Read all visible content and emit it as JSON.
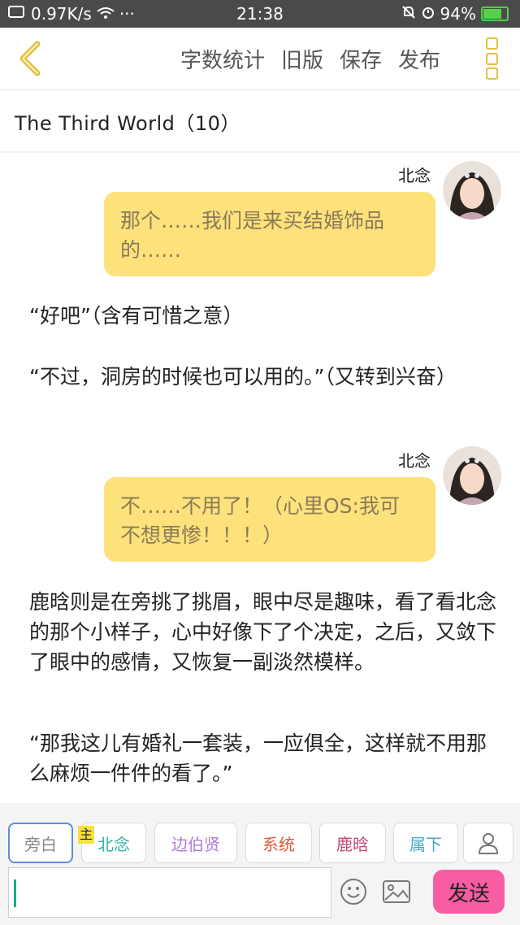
{
  "status_bar": {
    "speed": "0.97K/s",
    "more": "···",
    "time": "21:38",
    "battery": "94%"
  },
  "top_bar": {
    "menu": [
      "字数统计",
      "旧版",
      "保存",
      "发布"
    ]
  },
  "title": "The Third World（10）",
  "story": {
    "msg1": {
      "speaker": "北念",
      "text": "那个……我们是来买结婚饰品的……"
    },
    "narr1": "“好吧”（含有可惜之意）",
    "narr2": "“不过，洞房的时候也可以用的。”（又转到兴奋）",
    "msg2": {
      "speaker": "北念",
      "text": "不……不用了！（心里OS:我可不想更惨！！！）"
    },
    "narr3": "鹿晗则是在旁挑了挑眉，眼中尽是趣味，看了看北念的那个小样子，心中好像下了个决定，之后，又敛下了眼中的感情，又恢复一副淡然模样。",
    "narr4": "“那我这儿有婚礼一套装，一应俱全，这样就不用那么麻烦一件件的看了。”"
  },
  "roles": {
    "main_badge": "主",
    "chips": [
      {
        "label": "旁白",
        "color": "#888888"
      },
      {
        "label": "北念",
        "color": "#2ab7a9"
      },
      {
        "label": "边伯贤",
        "color": "#b07ad6"
      },
      {
        "label": "系统",
        "color": "#e05a3a"
      },
      {
        "label": "鹿晗",
        "color": "#c2497a"
      },
      {
        "label": "属下",
        "color": "#4aa8c9"
      }
    ]
  },
  "composer": {
    "send": "发送"
  },
  "colors": {
    "accent": "#e2c046",
    "bubble": "#fde27c",
    "send": "#f85da3"
  }
}
